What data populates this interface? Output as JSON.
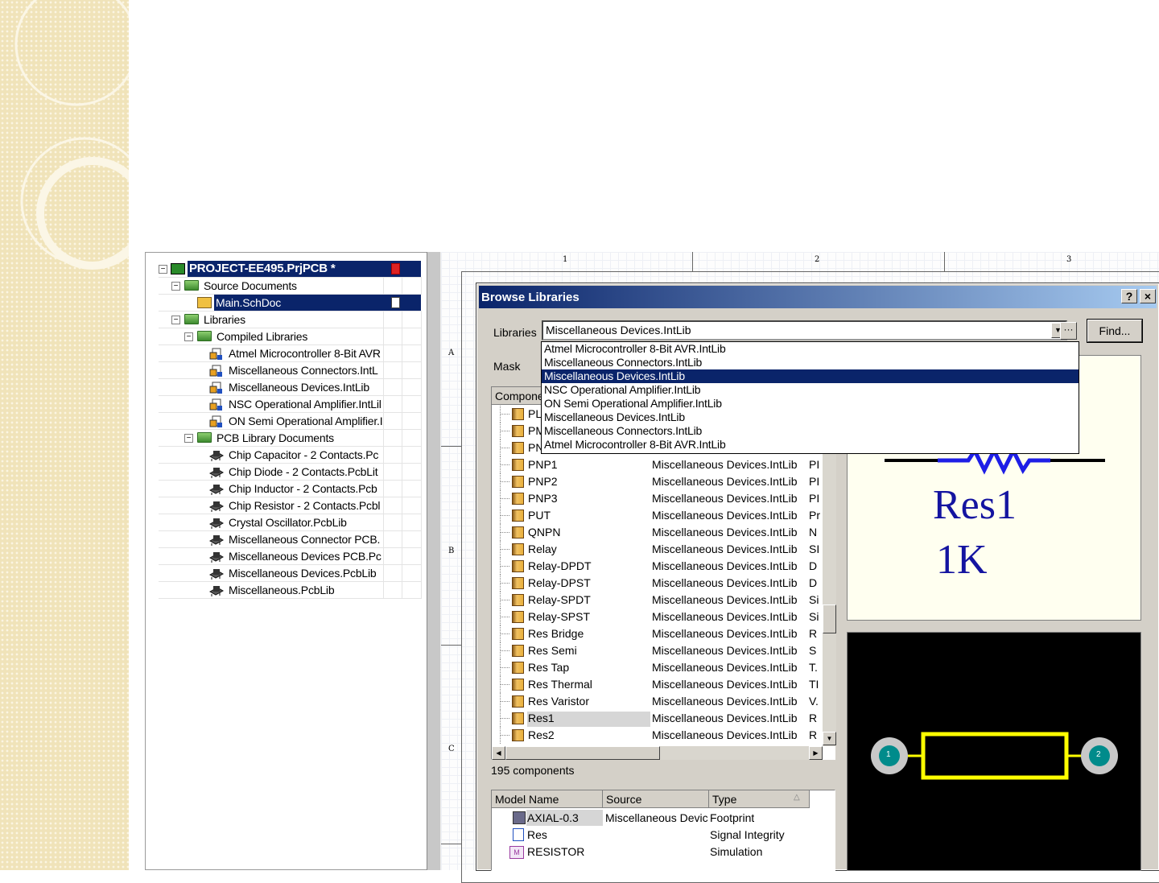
{
  "project_tree": {
    "root": "PROJECT-EE495.PrjPCB *",
    "source_documents": "Source Documents",
    "main_doc": "Main.SchDoc",
    "libraries": "Libraries",
    "compiled_libraries": "Compiled Libraries",
    "compiled": [
      "Atmel Microcontroller 8-Bit AVR",
      "Miscellaneous Connectors.IntL",
      "Miscellaneous Devices.IntLib",
      "NSC Operational Amplifier.IntLil",
      "ON Semi Operational Amplifier.I"
    ],
    "pcb_library_documents": "PCB Library Documents",
    "pcb_libs": [
      "Chip Capacitor - 2 Contacts.Pc",
      "Chip Diode - 2 Contacts.PcbLit",
      "Chip Inductor - 2 Contacts.Pcb",
      "Chip Resistor - 2 Contacts.Pcbl",
      "Crystal Oscillator.PcbLib",
      "Miscellaneous Connector PCB.",
      "Miscellaneous Devices PCB.Pc",
      "Miscellaneous Devices.PcbLib",
      "Miscellaneous.PcbLib"
    ]
  },
  "schematic": {
    "zones_x": [
      "1",
      "2",
      "3"
    ],
    "zones_y": [
      "A",
      "B",
      "C"
    ]
  },
  "dialog": {
    "title": "Browse Libraries",
    "help": "?",
    "close": "×",
    "libraries_label": "Libraries",
    "libraries_value": "Miscellaneous Devices.IntLib",
    "find_button": "Find...",
    "dots_button": "···",
    "mask_label": "Mask",
    "dropdown_items": [
      "Atmel Microcontroller 8-Bit AVR.IntLib",
      "Miscellaneous Connectors.IntLib",
      "Miscellaneous Devices.IntLib",
      "NSC Operational Amplifier.IntLib",
      "ON Semi Operational Amplifier.IntLib",
      "Miscellaneous Devices.IntLib",
      "Miscellaneous Connectors.IntLib",
      "Atmel Microcontroller 8-Bit AVR.IntLib"
    ],
    "component_header": "Compone",
    "partial_rows": [
      "PL",
      "PM",
      "PN"
    ],
    "components": [
      {
        "name": "PNP1",
        "source": "Miscellaneous Devices.IntLib",
        "type": "PI"
      },
      {
        "name": "PNP2",
        "source": "Miscellaneous Devices.IntLib",
        "type": "PI"
      },
      {
        "name": "PNP3",
        "source": "Miscellaneous Devices.IntLib",
        "type": "PI"
      },
      {
        "name": "PUT",
        "source": "Miscellaneous Devices.IntLib",
        "type": "Pr"
      },
      {
        "name": "QNPN",
        "source": "Miscellaneous Devices.IntLib",
        "type": "N"
      },
      {
        "name": "Relay",
        "source": "Miscellaneous Devices.IntLib",
        "type": "SI"
      },
      {
        "name": "Relay-DPDT",
        "source": "Miscellaneous Devices.IntLib",
        "type": "D"
      },
      {
        "name": "Relay-DPST",
        "source": "Miscellaneous Devices.IntLib",
        "type": "D"
      },
      {
        "name": "Relay-SPDT",
        "source": "Miscellaneous Devices.IntLib",
        "type": "Si"
      },
      {
        "name": "Relay-SPST",
        "source": "Miscellaneous Devices.IntLib",
        "type": "Si"
      },
      {
        "name": "Res Bridge",
        "source": "Miscellaneous Devices.IntLib",
        "type": "R"
      },
      {
        "name": "Res Semi",
        "source": "Miscellaneous Devices.IntLib",
        "type": "S"
      },
      {
        "name": "Res Tap",
        "source": "Miscellaneous Devices.IntLib",
        "type": "T."
      },
      {
        "name": "Res Thermal",
        "source": "Miscellaneous Devices.IntLib",
        "type": "TI"
      },
      {
        "name": "Res Varistor",
        "source": "Miscellaneous Devices.IntLib",
        "type": "V."
      },
      {
        "name": "Res1",
        "source": "Miscellaneous Devices.IntLib",
        "type": "R"
      },
      {
        "name": "Res2",
        "source": "Miscellaneous Devices.IntLib",
        "type": "R"
      }
    ],
    "selected_component": "Res1",
    "component_count": "195 components",
    "model_headers": [
      "Model Name",
      "Source",
      "Type"
    ],
    "models": [
      {
        "name": "AXIAL-0.3",
        "source": "Miscellaneous Devic",
        "type": "Footprint"
      },
      {
        "name": "Res",
        "source": "",
        "type": "Signal Integrity"
      },
      {
        "name": "RESISTOR",
        "source": "",
        "type": "Simulation"
      }
    ],
    "preview_designator": "Res1",
    "preview_value": "1K",
    "pad_labels": [
      "1",
      "2"
    ]
  },
  "colors": {
    "selection": "#0a246a",
    "title_bar_start": "#0a246a",
    "title_bar_end": "#a6caf0",
    "resistor_wire": "#1e1ee6",
    "pcb_outline": "#ffff00",
    "pad": "#008b8b"
  }
}
